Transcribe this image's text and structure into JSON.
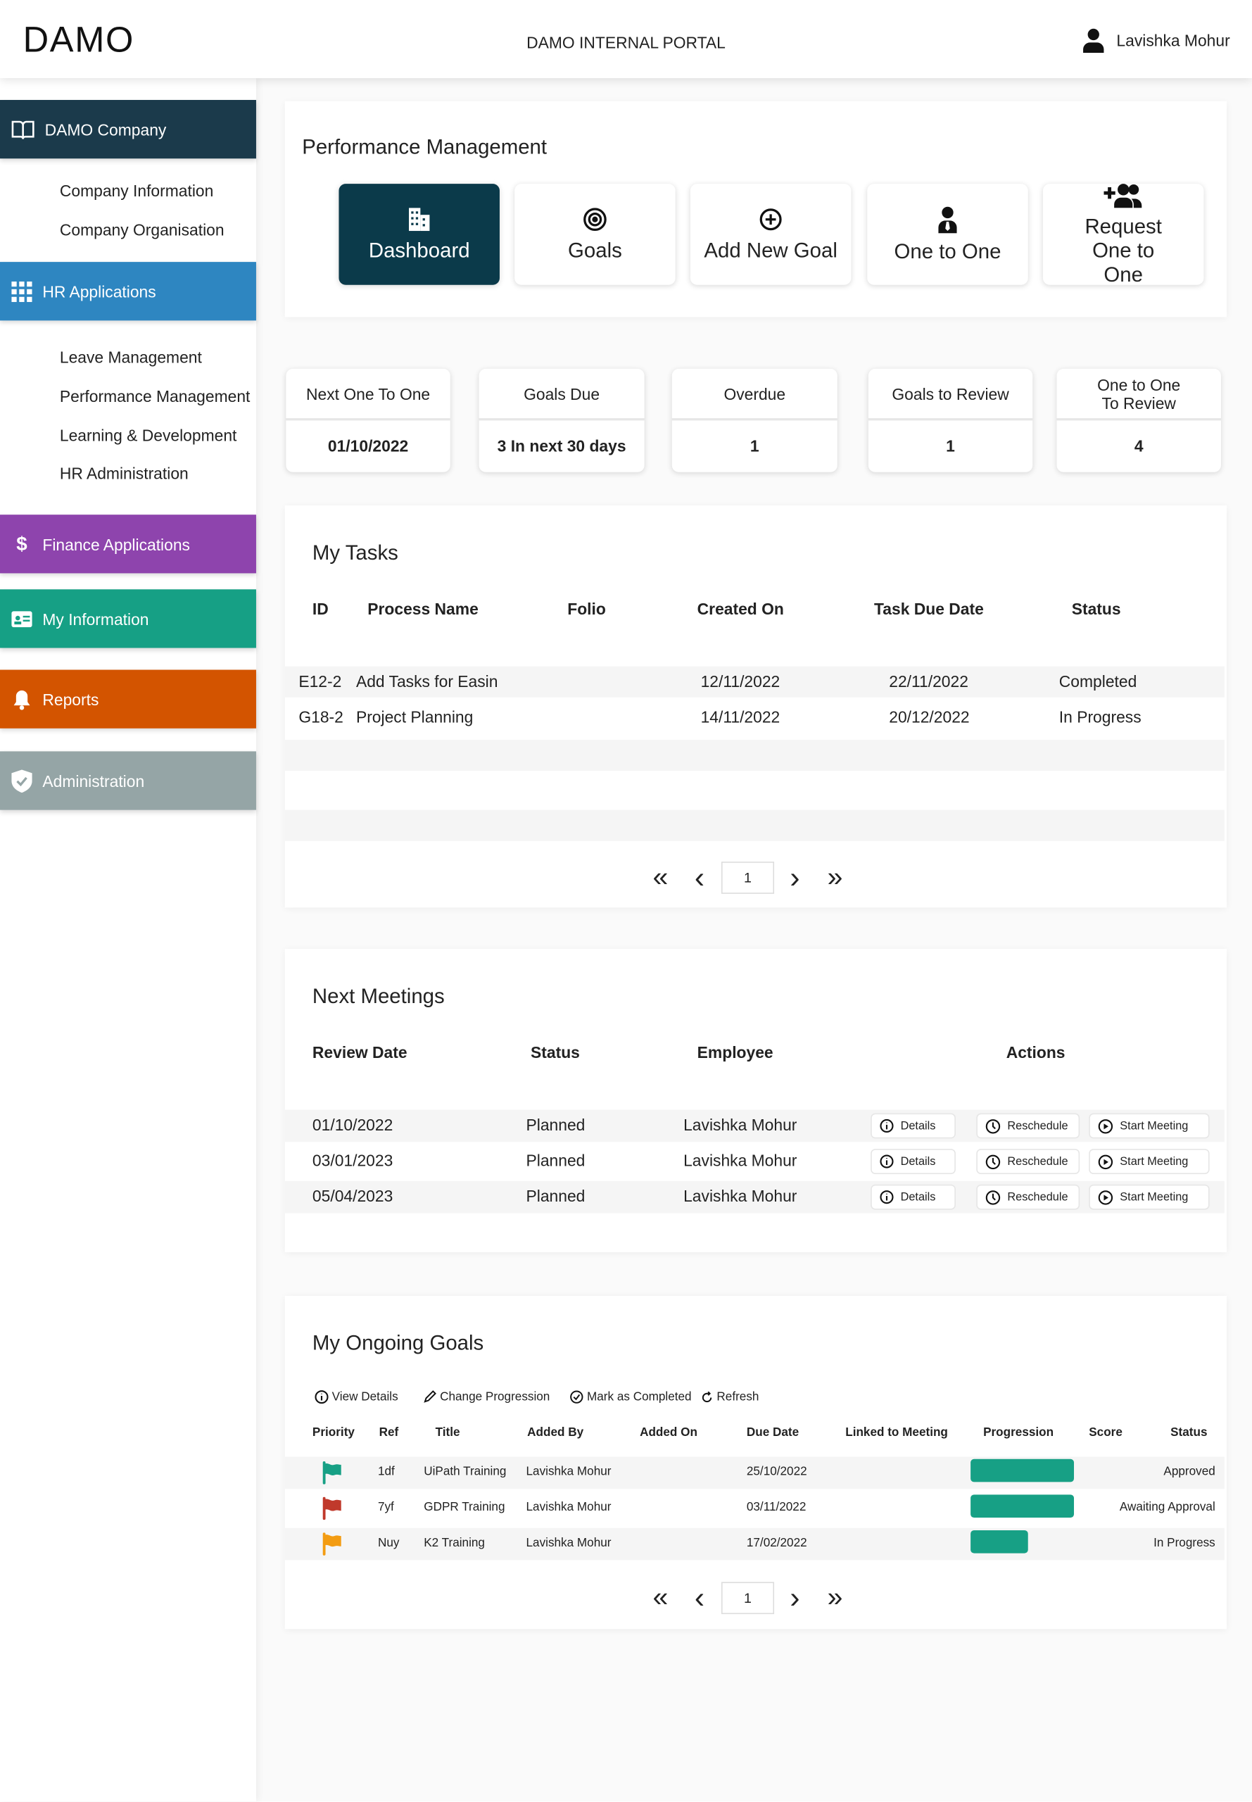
{
  "header": {
    "logo": "DAMO",
    "portal_title": "DAMO INTERNAL PORTAL",
    "user_name": "Lavishka Mohur"
  },
  "sidebar": {
    "sections": [
      {
        "label": "DAMO Company",
        "icon": "book-icon",
        "color": "#1b3a4b",
        "items": [
          "Company Information",
          "Company Organisation"
        ]
      },
      {
        "label": "HR Applications",
        "icon": "grid-icon",
        "color": "#2e86c1",
        "items": [
          "Leave Management",
          "Performance Management",
          "Learning & Development",
          "HR Administration"
        ]
      },
      {
        "label": "Finance Applications",
        "icon": "dollar-icon",
        "color": "#8e44ad",
        "items": []
      },
      {
        "label": "My Information",
        "icon": "id-card-icon",
        "color": "#16a085",
        "items": []
      },
      {
        "label": "Reports",
        "icon": "bell-icon",
        "color": "#d35400",
        "items": []
      },
      {
        "label": "Administration",
        "icon": "shield-icon",
        "color": "#95a5a6",
        "items": []
      }
    ]
  },
  "performance": {
    "title": "Performance Management",
    "buttons": [
      {
        "label": "Dashboard",
        "icon": "building-icon",
        "active": true
      },
      {
        "label": "Goals",
        "icon": "target-icon"
      },
      {
        "label": "Add New Goal",
        "icon": "plus-circle-icon"
      },
      {
        "label": "One to One",
        "icon": "user-tie-icon"
      },
      {
        "label": "Request One to One",
        "icon": "user-plus-icon"
      }
    ]
  },
  "stats": [
    {
      "label": "Next One To One",
      "value": "01/10/2022"
    },
    {
      "label": "Goals Due",
      "value": "3 In next 30 days"
    },
    {
      "label": "Overdue",
      "value": "1"
    },
    {
      "label": "Goals to Review",
      "value": "1"
    },
    {
      "label": "One to One To Review",
      "value": "4"
    }
  ],
  "tasks": {
    "title": "My Tasks",
    "columns": [
      "ID",
      "Process Name",
      "Folio",
      "Created On",
      "Task Due Date",
      "Status"
    ],
    "rows": [
      [
        "E12-2",
        "Add Tasks for Easin",
        "",
        "12/11/2022",
        "22/11/2022",
        "Completed"
      ],
      [
        "G18-2",
        "Project Planning",
        "",
        "14/11/2022",
        "20/12/2022",
        "In Progress"
      ]
    ],
    "page": "1"
  },
  "meetings": {
    "title": "Next Meetings",
    "columns": [
      "Review Date",
      "Status",
      "Employee",
      "Actions"
    ],
    "actions": [
      "Details",
      "Reschedule",
      "Start Meeting"
    ],
    "rows": [
      [
        "01/10/2022",
        "Planned",
        "Lavishka Mohur"
      ],
      [
        "03/01/2023",
        "Planned",
        "Lavishka Mohur"
      ],
      [
        "05/04/2023",
        "Planned",
        "Lavishka Mohur"
      ]
    ]
  },
  "goals": {
    "title": "My Ongoing Goals",
    "toolbar": [
      "View Details",
      "Change Progression",
      "Mark as Completed",
      "Refresh"
    ],
    "columns": [
      "Priority",
      "Ref",
      "Title",
      "Added By",
      "Added On",
      "Due Date",
      "Linked to Meeting",
      "Progression",
      "Score",
      "Status"
    ],
    "rows": [
      {
        "priority_color": "#17a085",
        "ref": "1df",
        "title": "UiPath Training",
        "added_by": "Lavishka Mohur",
        "added_on": "",
        "due": "25/10/2022",
        "linked": "",
        "progress": 100,
        "score": "",
        "status": "Approved"
      },
      {
        "priority_color": "#c0392b",
        "ref": "7yf",
        "title": "GDPR Training",
        "added_by": "Lavishka Mohur",
        "added_on": "",
        "due": "03/11/2022",
        "linked": "",
        "progress": 100,
        "score": "",
        "status": "Awaiting Approval"
      },
      {
        "priority_color": "#f39c12",
        "ref": "Nuy",
        "title": "K2 Training",
        "added_by": "Lavishka Mohur",
        "added_on": "",
        "due": "17/02/2022",
        "linked": "",
        "progress": 56,
        "score": "",
        "status": "In Progress"
      }
    ],
    "page": "1"
  }
}
